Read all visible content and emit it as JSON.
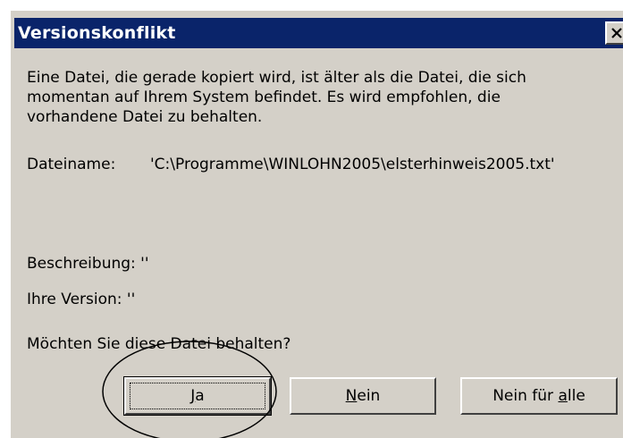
{
  "dialog": {
    "title": "Versionskonflikt",
    "intro_lines": [
      "Eine Datei, die gerade kopiert wird, ist älter als die Datei, die sich",
      "momentan auf Ihrem System befindet. Es wird empfohlen, die",
      "vorhandene Datei zu behalten."
    ],
    "filename_label": "Dateiname:",
    "filename_value": "'C:\\Programme\\WINLOHN2005\\elsterhinweis2005.txt'",
    "description": "Beschreibung: ''",
    "your_version": "Ihre Version: ''",
    "question": "Möchten Sie diese Datei behalten?"
  },
  "buttons": {
    "yes": {
      "prefix": "",
      "accel": "J",
      "suffix": "a"
    },
    "no": {
      "prefix": "",
      "accel": "N",
      "suffix": "ein"
    },
    "no_all": {
      "prefix": "Nein für ",
      "accel": "a",
      "suffix": "lle"
    }
  },
  "icons": {
    "close": "close-icon"
  },
  "colors": {
    "titlebar": "#0a246a",
    "face": "#d4d0c8"
  }
}
